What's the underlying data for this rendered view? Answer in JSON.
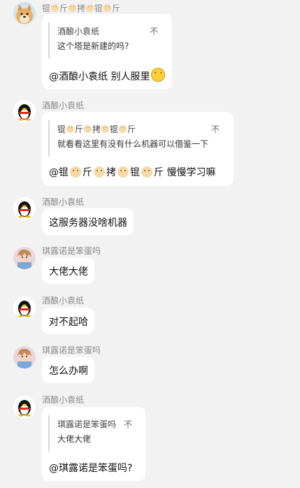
{
  "messages": [
    {
      "sender": "锟☺斤☺拷☺锟☺斤",
      "sender_parts": [
        "锟",
        "斤",
        "拷",
        "锟",
        "斤"
      ],
      "avatar": "doge-avatar",
      "quote": {
        "name": "酒酿小袁纸",
        "close": "不",
        "text": "这个塔是新建的吗?"
      },
      "text": "@酒酿小袁纸 别人服里",
      "emoji": "grinning-emoji"
    },
    {
      "sender": "酒酿小袁纸",
      "avatar": "qq-penguin-avatar",
      "quote": {
        "name_parts": [
          "锟",
          "斤",
          "拷",
          "锟",
          "斤"
        ],
        "close": "不",
        "text": "就看看这里有没有什么机器可以借鉴一下"
      },
      "text_parts": [
        "@锟",
        "斤",
        "拷",
        "锟",
        "斤"
      ],
      "text_tail": "慢慢学习嘛"
    },
    {
      "sender": "酒酿小袁纸",
      "avatar": "qq-penguin-avatar",
      "text": "这服务器没啥机器"
    },
    {
      "sender": "琪露诺是笨蛋吗",
      "avatar": "anime-avatar",
      "text": "大佬大佬"
    },
    {
      "sender": "酒酿小袁纸",
      "avatar": "qq-penguin-avatar",
      "text": "对不起哈"
    },
    {
      "sender": "琪露诺是笨蛋吗",
      "avatar": "anime-avatar",
      "text": "怎么办啊"
    },
    {
      "sender": "酒酿小袁纸",
      "avatar": "qq-penguin-avatar",
      "quote": {
        "name": "琪露诺是笨蛋吗",
        "close": "不",
        "text": "大佬大佬"
      },
      "text": "@琪露诺是笨蛋吗?"
    }
  ]
}
